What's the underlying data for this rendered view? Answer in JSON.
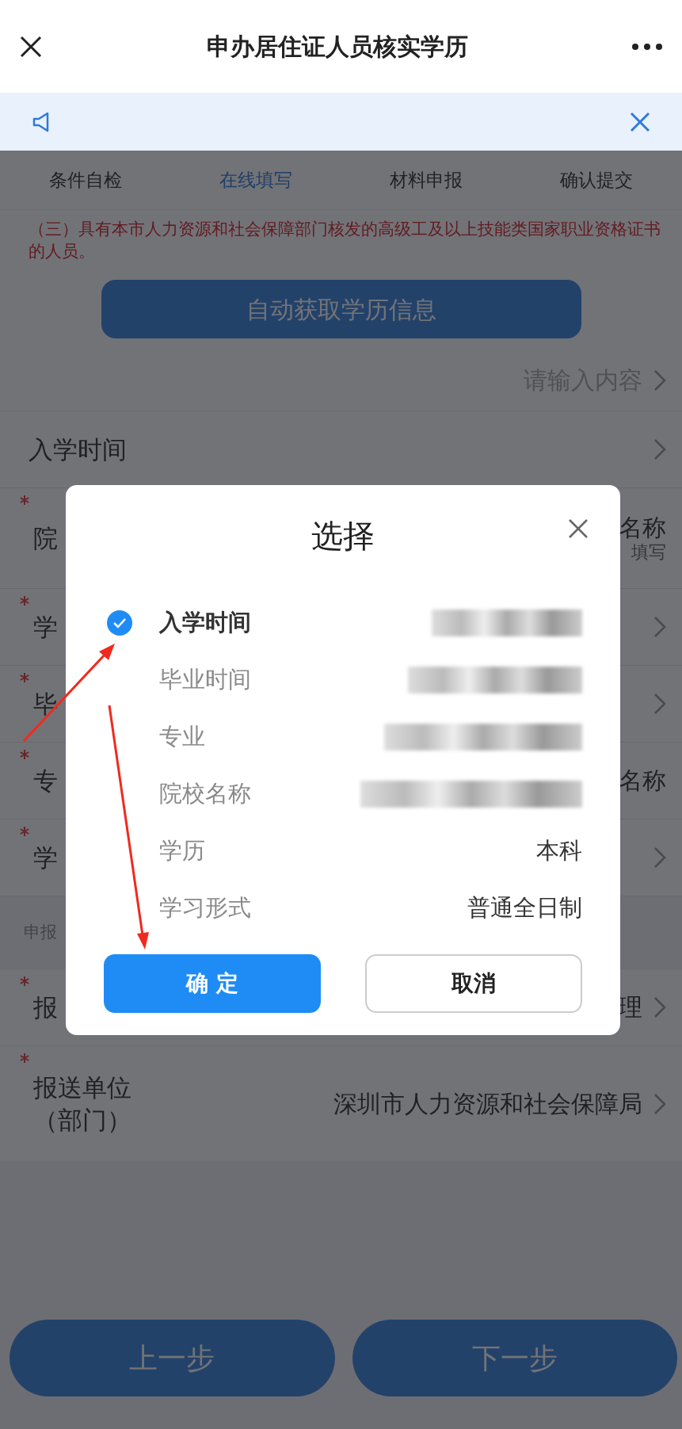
{
  "header": {
    "title": "申办居住证人员核实学历"
  },
  "steps": [
    {
      "label": "条件自检",
      "selected": false
    },
    {
      "label": "在线填写",
      "selected": true
    },
    {
      "label": "材料申报",
      "selected": false
    },
    {
      "label": "确认提交",
      "selected": false
    }
  ],
  "note": "（三）具有本市人力资源和社会保障部门核发的高级工及以上技能类国家职业资格证书的人员。",
  "auto_fetch_button": "自动获取学历信息",
  "form_rows": [
    {
      "kind": "field",
      "required": false,
      "placeholder": "请输入内容",
      "chevron": true
    },
    {
      "kind": "field",
      "required": false,
      "label": "入学时间",
      "chevron": true
    },
    {
      "kind": "field",
      "required": true,
      "label": "院",
      "value": "名称",
      "hint": "填写"
    },
    {
      "kind": "field",
      "required": true,
      "label": "学",
      "chevron": true
    },
    {
      "kind": "field",
      "required": true,
      "label": "毕",
      "chevron": true
    },
    {
      "kind": "field",
      "required": true,
      "label": "专",
      "value": "名称"
    },
    {
      "kind": "field",
      "required": true,
      "label": "学",
      "chevron": true
    },
    {
      "kind": "section",
      "label": "申报"
    },
    {
      "kind": "field",
      "required": true,
      "label": "报",
      "value": "理",
      "chevron": true
    },
    {
      "kind": "field",
      "required": true,
      "label": "报送单位",
      "sublabel": "（部门）",
      "value": "深圳市人力资源和社会保障局",
      "chevron": true
    }
  ],
  "footer_buttons": [
    "上一步",
    "下一步"
  ],
  "modal": {
    "title": "选择",
    "rows": [
      {
        "label": "入学时间",
        "checked": true,
        "redacted": true
      },
      {
        "label": "毕业时间",
        "checked": false,
        "redacted": true
      },
      {
        "label": "专业",
        "checked": false,
        "redacted": true
      },
      {
        "label": "院校名称",
        "checked": false,
        "redacted": true
      },
      {
        "label": "学历",
        "checked": false,
        "redacted": false,
        "value": "本科"
      },
      {
        "label": "学习形式",
        "checked": false,
        "redacted": false,
        "value": "普通全日制"
      }
    ],
    "buttons": [
      {
        "kind": "primary",
        "label": "确 定"
      },
      {
        "kind": "secondary",
        "label": "取消"
      }
    ]
  }
}
